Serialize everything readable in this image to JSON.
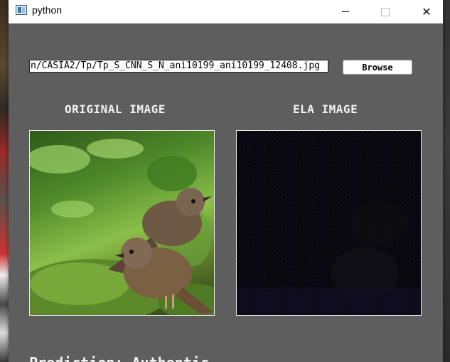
{
  "window": {
    "title": "python"
  },
  "controls": {
    "file_path": "n/CASIA2/Tp/Tp_S_CNN_S_N_ani10199_ani10199_12408.jpg",
    "browse_label": "Browse"
  },
  "headings": {
    "original": "ORIGINAL IMAGE",
    "ela": "ELA IMAGE"
  },
  "result": {
    "prediction_text": "Prediction: Authentic"
  },
  "icons": [
    "python-window-icon",
    "minimize-icon",
    "maximize-icon",
    "close-icon"
  ],
  "colors": {
    "window_bg": "#5e5e5e",
    "titlebar_bg": "#ffffff",
    "heading_text": "#f2f2f2"
  }
}
